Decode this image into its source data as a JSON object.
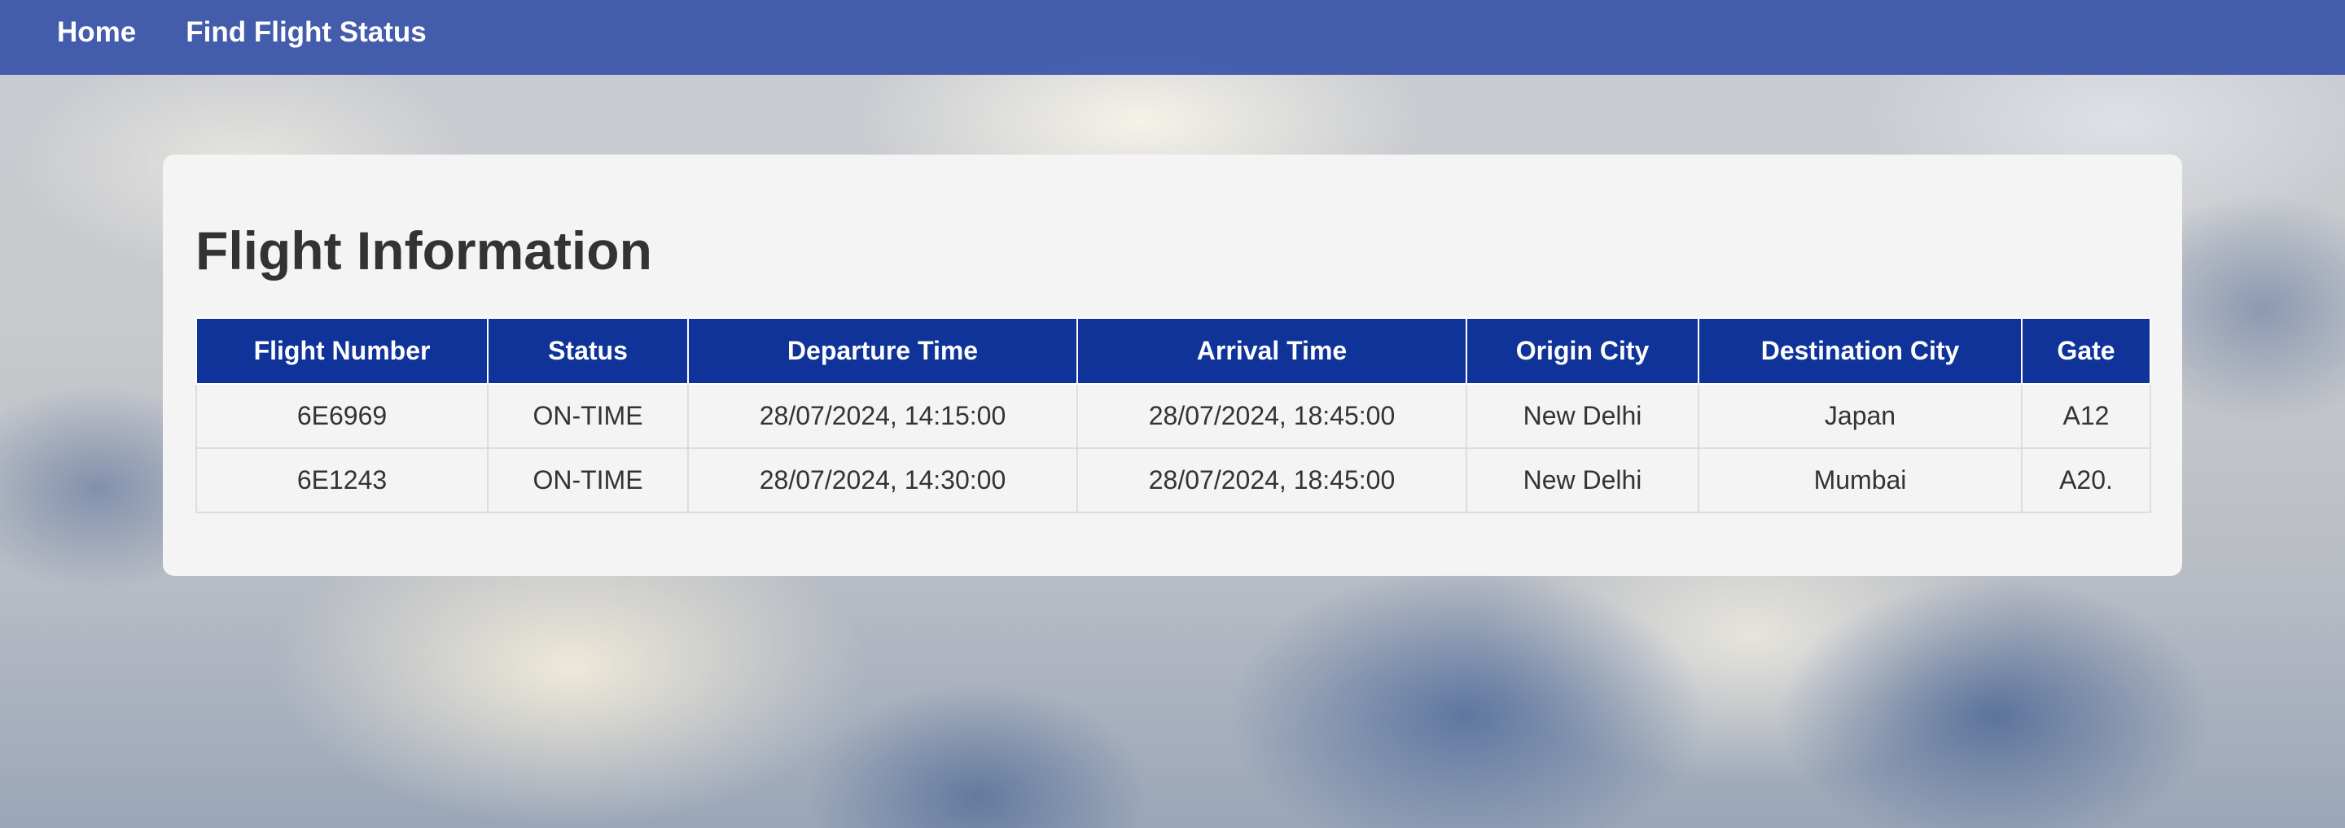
{
  "nav": {
    "home": "Home",
    "find_status": "Find Flight Status"
  },
  "page": {
    "title": "Flight Information"
  },
  "table": {
    "headers": [
      "Flight Number",
      "Status",
      "Departure Time",
      "Arrival Time",
      "Origin City",
      "Destination City",
      "Gate"
    ],
    "rows": [
      [
        "6E6969",
        "ON-TIME",
        "28/07/2024, 14:15:00",
        "28/07/2024, 18:45:00",
        "New Delhi",
        "Japan",
        "A12"
      ],
      [
        "6E1243",
        "ON-TIME",
        "28/07/2024, 14:30:00",
        "28/07/2024, 18:45:00",
        "New Delhi",
        "Mumbai",
        "A20."
      ]
    ]
  },
  "colors": {
    "nav_bg": "#3752a8",
    "table_header_bg": "#0f3399",
    "card_bg": "#f4f4f4"
  }
}
